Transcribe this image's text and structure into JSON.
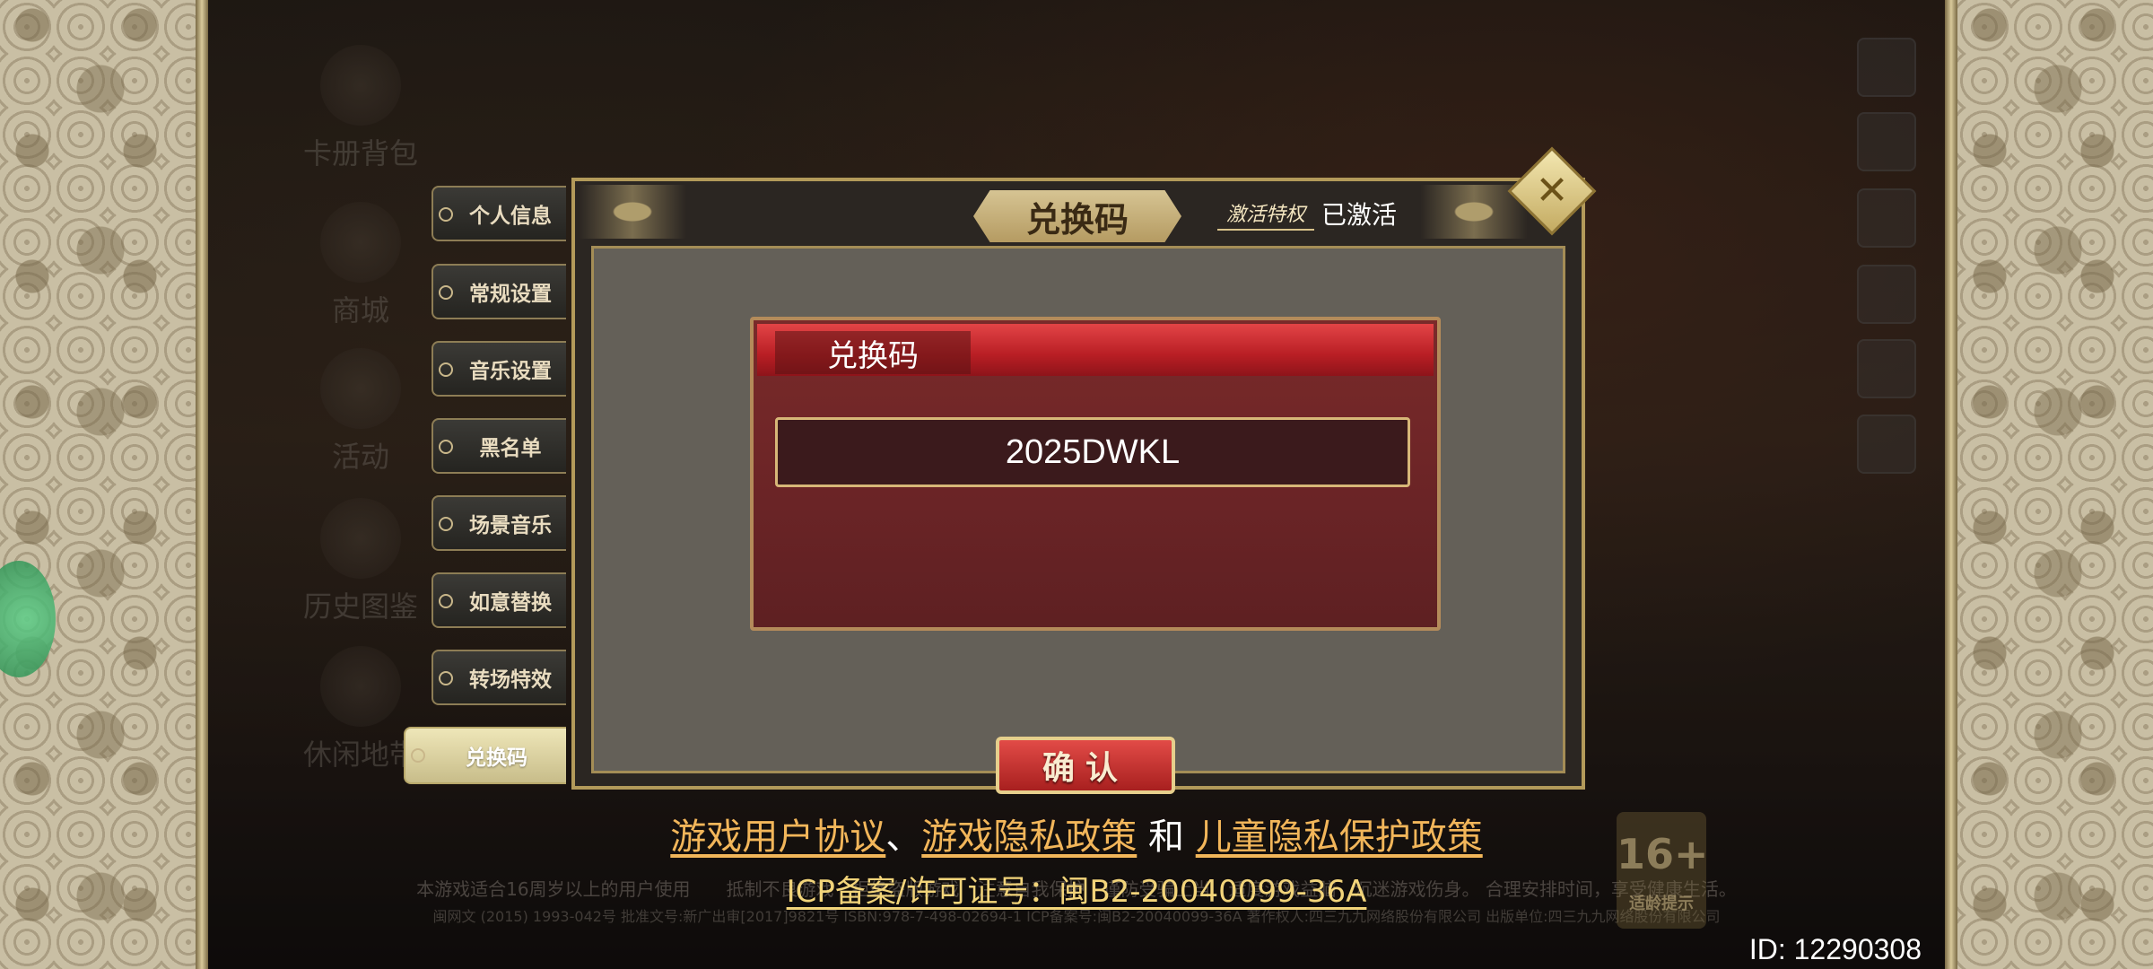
{
  "background_menu": [
    {
      "label": "卡册背包"
    },
    {
      "label": "商城"
    },
    {
      "label": "活动"
    },
    {
      "label": "历史图鉴"
    },
    {
      "label": "休闲地带"
    }
  ],
  "side_tabs": [
    {
      "label": "个人信息",
      "active": false
    },
    {
      "label": "常规设置",
      "active": false
    },
    {
      "label": "音乐设置",
      "active": false
    },
    {
      "label": "黑名单",
      "active": false
    },
    {
      "label": "场景音乐",
      "active": false
    },
    {
      "label": "如意替换",
      "active": false
    },
    {
      "label": "转场特效",
      "active": false
    },
    {
      "label": "兑换码",
      "active": true
    }
  ],
  "panel": {
    "title": "兑换码",
    "activation_badge": "激活特权",
    "activation_status": "已激活",
    "close_icon": "✕"
  },
  "redeem": {
    "header_label": "兑换码",
    "code_value": "2025DWKL",
    "confirm_label": "确认"
  },
  "footer": {
    "user_agreement": "游戏用户协议",
    "separator": "、",
    "privacy_policy": "游戏隐私政策",
    "conjunction": "和",
    "child_privacy": "儿童隐私保护政策",
    "icp": "ICP备案/许可证号：闽B2-20040099-36A",
    "age_notice": "本游戏适合16周岁以上的用户使用　　抵制不良游戏　拒绝盗版游戏　注意自我保护　谨防受骗上当　适度游戏益脑　沉迷游戏伤身。 合理安排时间，享受健康生活。",
    "license": "闽网文 (2015) 1993-042号 批准文号:新广出审[2017]9821号 ISBN:978-7-498-02694-1 ICP备案号:闽B2-20040099-36A 著作权人:四三九九网络股份有限公司 出版单位:四三九九网络股份有限公司",
    "id_label": "ID: 12290308"
  },
  "age_rating": {
    "value": "16+",
    "label": "适龄提示"
  },
  "colors": {
    "accent_gold": "#c9b37a",
    "link_orange": "#f2b65a",
    "card_red": "#b81e24"
  }
}
